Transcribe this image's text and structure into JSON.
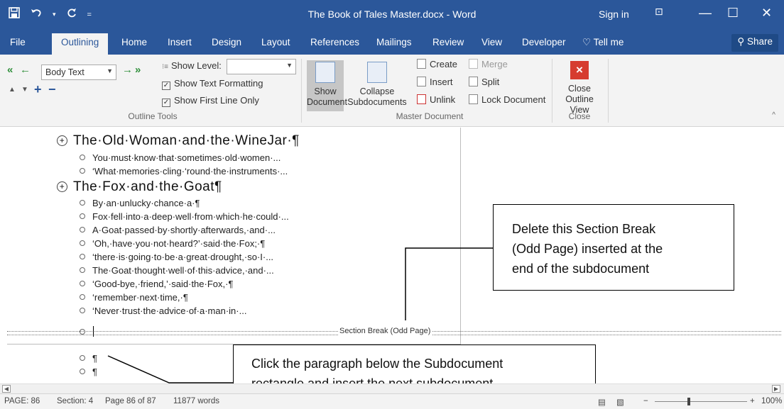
{
  "window": {
    "title": "The Book of Tales Master.docx - Word",
    "sign_in": "Sign in",
    "qat_save_icon": "save-icon",
    "qat_undo_icon": "undo-icon",
    "qat_redo_icon": "redo-icon",
    "minimize": "—",
    "restore": "☐",
    "close": "✕",
    "ribbon_display": "⊡"
  },
  "tabs": [
    {
      "label": "File"
    },
    {
      "label": "Outlining"
    },
    {
      "label": "Home"
    },
    {
      "label": "Insert"
    },
    {
      "label": "Design"
    },
    {
      "label": "Layout"
    },
    {
      "label": "References"
    },
    {
      "label": "Mailings"
    },
    {
      "label": "Review"
    },
    {
      "label": "View"
    },
    {
      "label": "Developer"
    },
    {
      "label": "Tell me"
    }
  ],
  "share_label": "Share",
  "ribbon": {
    "outline_tools": {
      "level_value": "Body Text",
      "show_level_label": "Show Level:",
      "show_text_formatting": "Show Text Formatting",
      "show_first_line_only": "Show First Line Only",
      "show_text_formatting_checked": true,
      "show_first_line_only_checked": true,
      "group_label": "Outline Tools"
    },
    "master_document": {
      "show_document_line1": "Show",
      "show_document_line2": "Document",
      "collapse_line1": "Collapse",
      "collapse_line2": "Subdocuments",
      "create": "Create",
      "insert": "Insert",
      "unlink": "Unlink",
      "merge": "Merge",
      "split": "Split",
      "lock_document": "Lock Document",
      "group_label": "Master Document"
    },
    "close": {
      "close_line1": "Close",
      "close_line2": "Outline View",
      "group_label": "Close"
    }
  },
  "document": {
    "heading1": "The·Old·Woman·and·the·WineJar·¶",
    "heading1_items": [
      "You·must·know·that·sometimes·old·women·...",
      "‘What·memories·cling·‘round·the·instruments·..."
    ],
    "heading2": "The·Fox·and·the·Goat¶",
    "heading2_items": [
      "By·an·unlucky·chance·a·¶",
      "Fox·fell·into·a·deep·well·from·which·he·could·...",
      "A·Goat·passed·by·shortly·afterwards,·and·...",
      "‘Oh,·have·you·not·heard?’·said·the·Fox;·¶",
      "‘there·is·going·to·be·a·great·drought,·so·I·...",
      "The·Goat·thought·well·of·this·advice,·and·...",
      "‘Good-bye,·friend,’·said·the·Fox,·¶",
      "‘remember·next·time,·¶",
      "‘Never·trust·the·advice·of·a·man·in·..."
    ],
    "section_break": "Section Break (Odd Page)",
    "after_items": [
      "¶",
      "¶"
    ]
  },
  "callouts": {
    "delete_break": [
      "Delete this Section Break",
      "(Odd Page) inserted at the",
      "end of the subdocument"
    ],
    "click_paragraph": [
      "Click the paragraph below the Subdocument",
      "rectangle and insert the next subdocument"
    ]
  },
  "statusbar": {
    "page": "PAGE: 86",
    "section": "Section: 4",
    "page_of": "Page 86 of 87",
    "words": "11877 words",
    "zoom": "100%"
  },
  "colors": {
    "accent": "#2b579a",
    "close_red": "#d63c2f",
    "arrow_green": "#2f8f3a"
  }
}
